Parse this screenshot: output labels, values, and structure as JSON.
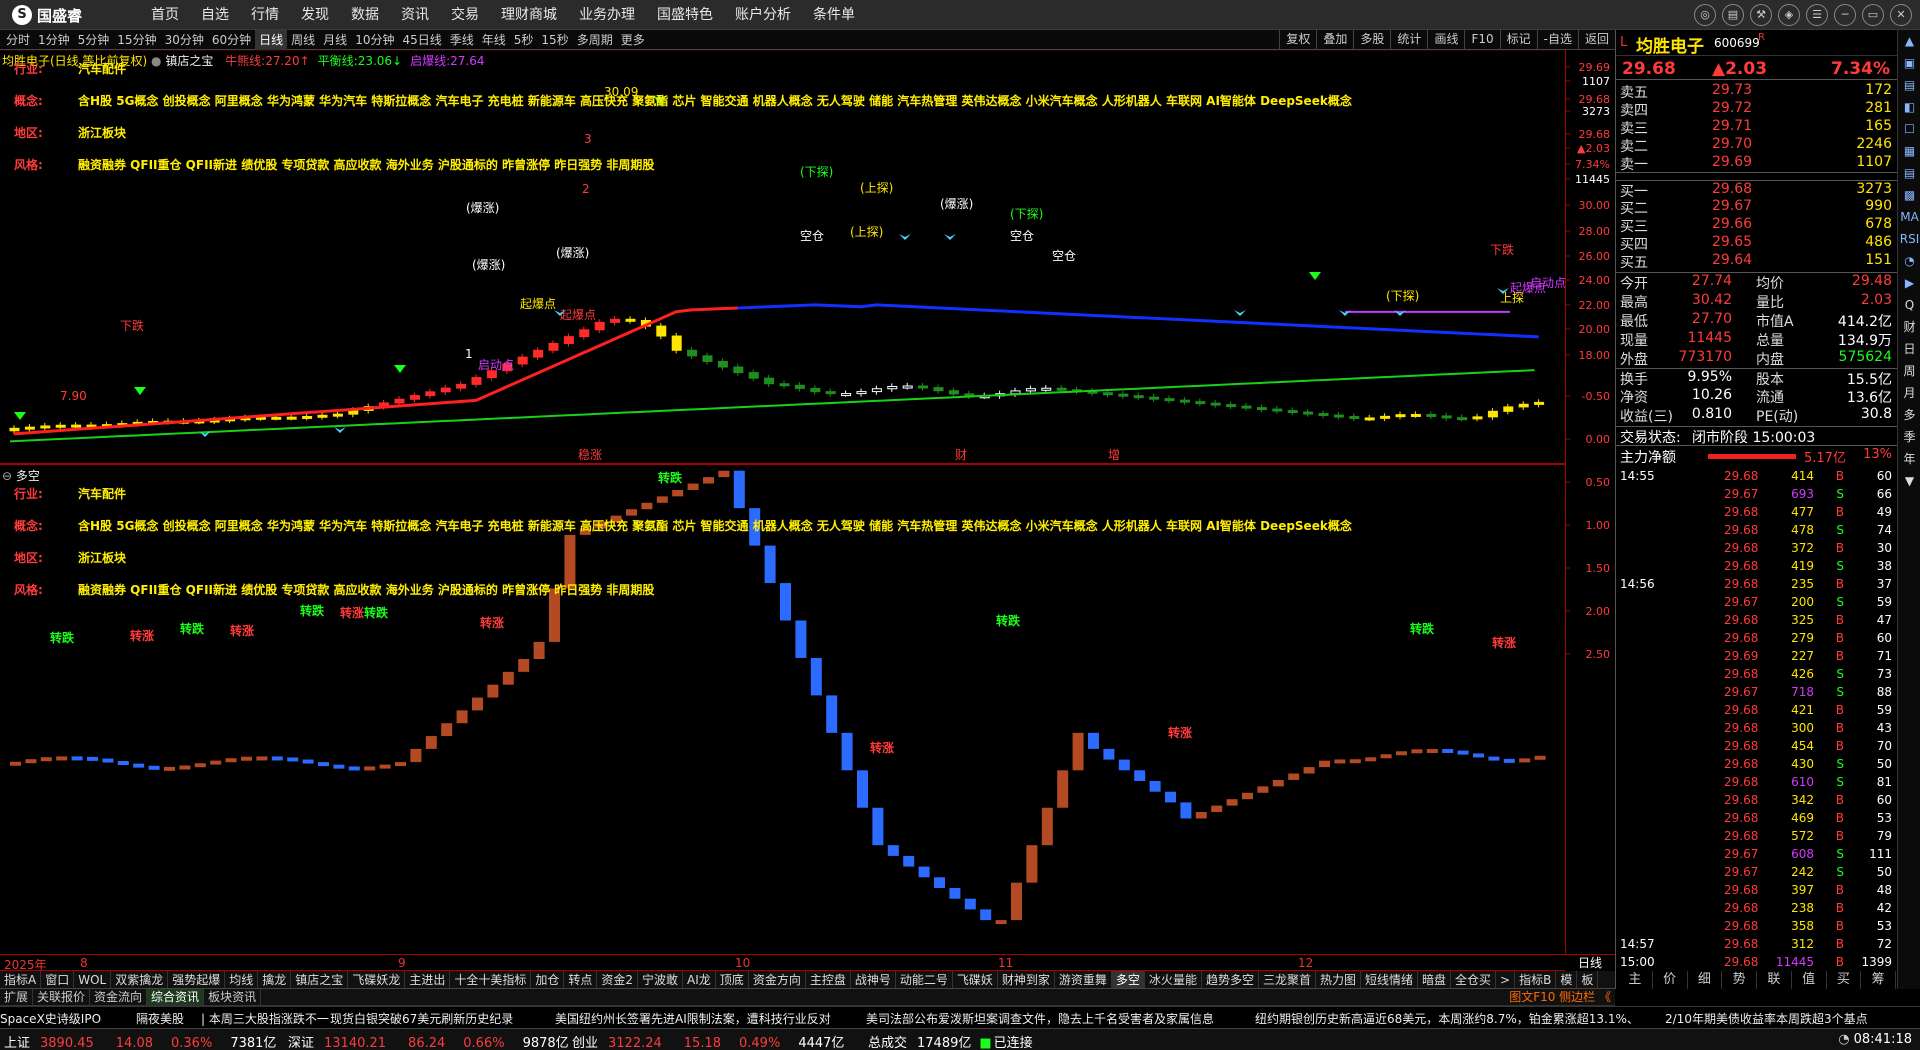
{
  "app": {
    "brand": "国盛睿",
    "nav": [
      "首页",
      "自选",
      "行情",
      "发现",
      "数据",
      "资讯",
      "交易",
      "理财商城",
      "业务办理",
      "国盛特色",
      "账户分析",
      "条件单"
    ],
    "win_buttons": [
      "chat-icon",
      "message-icon",
      "tools-icon",
      "skin-icon",
      "menu-icon",
      "minimize-icon",
      "maximize-icon",
      "close-icon"
    ],
    "win_glyphs": [
      "◎",
      "▤",
      "⚒",
      "◈",
      "☰",
      "─",
      "▭",
      "✕"
    ]
  },
  "toolbar": {
    "periods": [
      "分时",
      "1分钟",
      "5分钟",
      "15分钟",
      "30分钟",
      "60分钟",
      "日线",
      "周线",
      "月线",
      "10分钟",
      "45日线",
      "季线",
      "年线",
      "5秒",
      "15秒",
      "多周期",
      "更多"
    ],
    "active": "日线",
    "right": [
      "复权",
      "叠加",
      "多股",
      "统计",
      "画线",
      "F10",
      "标记",
      "-自选",
      "返回"
    ]
  },
  "main": {
    "title": "均胜电子(日线,等比前复权)",
    "indicator": "镇店之宝",
    "lines": [
      {
        "label": "牛熊线:",
        "value": "27.20",
        "color": "#ff3b3b"
      },
      {
        "label": "平衡线:",
        "value": "23.06",
        "color": "#1aff1a"
      },
      {
        "label": "启爆线:",
        "value": "27.64",
        "color": "#d13bff"
      }
    ],
    "arrows": {
      "up": "↑",
      "down": "↓"
    },
    "yticks": [
      "29.69",
      "1107",
      "29.68",
      "3273",
      "29.68",
      "▲2.03",
      "7.34%",
      "11445",
      "30.00",
      "28.00",
      "26.00",
      "24.00",
      "22.00",
      "20.00",
      "18.00"
    ],
    "markers": [
      "稳涨",
      "财",
      "增"
    ],
    "labels": [
      "下跌",
      "(下探)",
      "(上探)",
      "空仓",
      "(爆涨)",
      "起爆点",
      "(下探)",
      "(上探)",
      "空仓",
      "空仓",
      "(爆涨)",
      "(下探)",
      "起爆点",
      "启动点",
      "下跌",
      "启动点",
      "起爆点",
      "上探",
      "30.09",
      "(爆涨)",
      "3",
      "2",
      "1",
      "7.90",
      "(爆涨)"
    ]
  },
  "info": [
    {
      "label": "行业:",
      "value": "汽车配件"
    },
    {
      "label": "概念:",
      "value": "含H股 5G概念 创投概念 阿里概念 华为鸿蒙 华为汽车 特斯拉概念 汽车电子 充电桩 新能源车 高压快充 聚氨酯 芯片 智能交通 机器人概念 无人驾驶 储能 汽车热管理 英伟达概念 小米汽车概念 人形机器人 车联网 AI智能体 DeepSeek概念"
    },
    {
      "label": "地区:",
      "value": "浙江板块"
    },
    {
      "label": "风格:",
      "value": "融资融券 QFII重仓 QFII新进 绩优股 专项贷款 高应收款 海外业务 沪股通标的 昨曾涨停 昨日强势 非周期股"
    }
  ],
  "sub": {
    "title": "多空",
    "yticks": [
      "2.50",
      "2.00",
      "1.50",
      "1.00",
      "0.50",
      "0.00",
      "-0.50"
    ],
    "labels": [
      "转跌",
      "转涨",
      "转跌",
      "转涨",
      "转跌",
      "转涨",
      "转跌",
      "转涨",
      "转跌",
      "转涨",
      "转跌",
      "转涨",
      "转跌",
      "转涨"
    ]
  },
  "xaxis": [
    "2025年",
    "8",
    "9",
    "10",
    "11",
    "12"
  ],
  "xline": "日线",
  "indtabs": [
    "指标A",
    "窗口",
    "WOL",
    "双紫擒龙",
    "强势起爆",
    "均线",
    "擒龙",
    "镇店之宝",
    "飞碟妖龙",
    "主进出",
    "十全十美指标",
    "加仓",
    "转点",
    "资金2",
    "宁波敢",
    "AI龙",
    "顶底",
    "资金方向",
    "主控盘",
    "战神号",
    "动能二号",
    "飞碟妖",
    "财神到家",
    "游资重舞",
    "多空",
    "冰火量能",
    "趋势多空",
    "三龙聚首",
    "热力图",
    "短线情绪",
    "暗盘",
    "全仓买",
    ">",
    "指标B",
    "模",
    "板"
  ],
  "indtab_active": "多空",
  "bottomtabs": [
    "扩展",
    "关联报价",
    "资金流向",
    "综合资讯",
    "板块资讯"
  ],
  "bottom_active": "综合资讯",
  "bottom_right": "图文F10 侧边栏 《",
  "ticker": [
    "SpaceX史诗级IPO",
    "隔夜美股",
    "| 本周三大股指涨跌不一",
    "现货白银突破67美元刷新历史纪录",
    "美国纽约州长签署先进AI限制法案，遭科技行业反对",
    "美司法部公布爱泼斯坦案调查文件，隐去上千名受害者及家属信息",
    "纽约期银创历史新高逼近68美元，本周涨约8.7%，铂金累涨超13.1%、",
    "2/10年期美债收益率本周跌超3个基点"
  ],
  "status": [
    {
      "name": "上证",
      "price": "3890.45",
      "chg": "14.08",
      "pct": "0.36%",
      "amt": "7381亿"
    },
    {
      "name": "深证",
      "price": "13140.21",
      "chg": "86.24",
      "pct": "0.66%",
      "amt": "9878亿"
    },
    {
      "name": "创业",
      "price": "3122.24",
      "chg": "15.18",
      "pct": "0.49%",
      "amt": "4447亿"
    }
  ],
  "status_extra": {
    "total_label": "总成交",
    "total": "17489亿",
    "conn": "已连接",
    "time": "08:41:18"
  },
  "quote": {
    "name": "均胜电子",
    "code": "600699",
    "marker": "L",
    "sub": "R",
    "price": "29.68",
    "change": "▲2.03",
    "pct": "7.34%"
  },
  "orderbook": {
    "sell": [
      [
        "卖五",
        "29.73",
        "172"
      ],
      [
        "卖四",
        "29.72",
        "281"
      ],
      [
        "卖三",
        "29.71",
        "165"
      ],
      [
        "卖二",
        "29.70",
        "2246"
      ],
      [
        "卖一",
        "29.69",
        "1107"
      ]
    ],
    "buy": [
      [
        "买一",
        "29.68",
        "3273"
      ],
      [
        "买二",
        "29.67",
        "990"
      ],
      [
        "买三",
        "29.66",
        "678"
      ],
      [
        "买四",
        "29.65",
        "486"
      ],
      [
        "买五",
        "29.64",
        "151"
      ]
    ]
  },
  "stats": [
    [
      "今开",
      "27.74",
      "均价",
      "29.48"
    ],
    [
      "最高",
      "30.42",
      "量比",
      "2.03"
    ],
    [
      "最低",
      "27.70",
      "市值A",
      "414.2亿"
    ],
    [
      "现量",
      "11445",
      "总量",
      "134.9万"
    ],
    [
      "外盘",
      "773170",
      "内盘",
      "575624"
    ],
    [
      "换手",
      "9.95%",
      "股本",
      "15.5亿"
    ],
    [
      "净资",
      "10.26",
      "流通",
      "13.6亿"
    ],
    [
      "收益(三)",
      "0.810",
      "PE(动)",
      "30.8"
    ]
  ],
  "trade_state": {
    "label": "交易状态:",
    "value": "闭市阶段 15:00:03"
  },
  "main_net": {
    "label": "主力净额",
    "value": "5.17亿",
    "pct": "13%"
  },
  "trades": [
    [
      "14:55",
      "29.68",
      "414",
      "B",
      "60"
    ],
    [
      "",
      "29.67",
      "693",
      "S",
      "66"
    ],
    [
      "",
      "29.68",
      "477",
      "B",
      "49"
    ],
    [
      "",
      "29.68",
      "478",
      "S",
      "74"
    ],
    [
      "",
      "29.68",
      "372",
      "B",
      "30"
    ],
    [
      "",
      "29.68",
      "419",
      "S",
      "38"
    ],
    [
      "14:56",
      "29.68",
      "235",
      "B",
      "37"
    ],
    [
      "",
      "29.67",
      "200",
      "S",
      "59"
    ],
    [
      "",
      "29.68",
      "325",
      "B",
      "47"
    ],
    [
      "",
      "29.68",
      "279",
      "B",
      "60"
    ],
    [
      "",
      "29.69",
      "227",
      "B",
      "71"
    ],
    [
      "",
      "29.68",
      "426",
      "S",
      "73"
    ],
    [
      "",
      "29.67",
      "718",
      "S",
      "88"
    ],
    [
      "",
      "29.68",
      "421",
      "B",
      "59"
    ],
    [
      "",
      "29.68",
      "300",
      "B",
      "43"
    ],
    [
      "",
      "29.68",
      "454",
      "B",
      "70"
    ],
    [
      "",
      "29.68",
      "430",
      "S",
      "50"
    ],
    [
      "",
      "29.68",
      "610",
      "S",
      "81"
    ],
    [
      "",
      "29.68",
      "342",
      "B",
      "60"
    ],
    [
      "",
      "29.68",
      "469",
      "B",
      "53"
    ],
    [
      "",
      "29.68",
      "572",
      "B",
      "79"
    ],
    [
      "",
      "29.67",
      "608",
      "S",
      "111"
    ],
    [
      "",
      "29.67",
      "242",
      "S",
      "50"
    ],
    [
      "",
      "29.68",
      "397",
      "B",
      "48"
    ],
    [
      "",
      "29.68",
      "238",
      "B",
      "42"
    ],
    [
      "",
      "29.68",
      "358",
      "B",
      "53"
    ],
    [
      "14:57",
      "29.68",
      "312",
      "B",
      "72"
    ],
    [
      "15:00",
      "29.68",
      "11445",
      "B",
      "1399"
    ]
  ],
  "right_tabs": [
    "▲",
    "▣",
    "▤",
    "◧",
    "☐",
    "▦",
    "▤",
    "▩",
    "MA",
    "RSI",
    "◔",
    "▶",
    "Q",
    "财",
    "日",
    "周",
    "月",
    "多",
    "季",
    "年",
    "▼"
  ],
  "bottom_panel": [
    "主",
    "价",
    "细",
    "势",
    "联",
    "值",
    "买",
    "筹"
  ]
}
